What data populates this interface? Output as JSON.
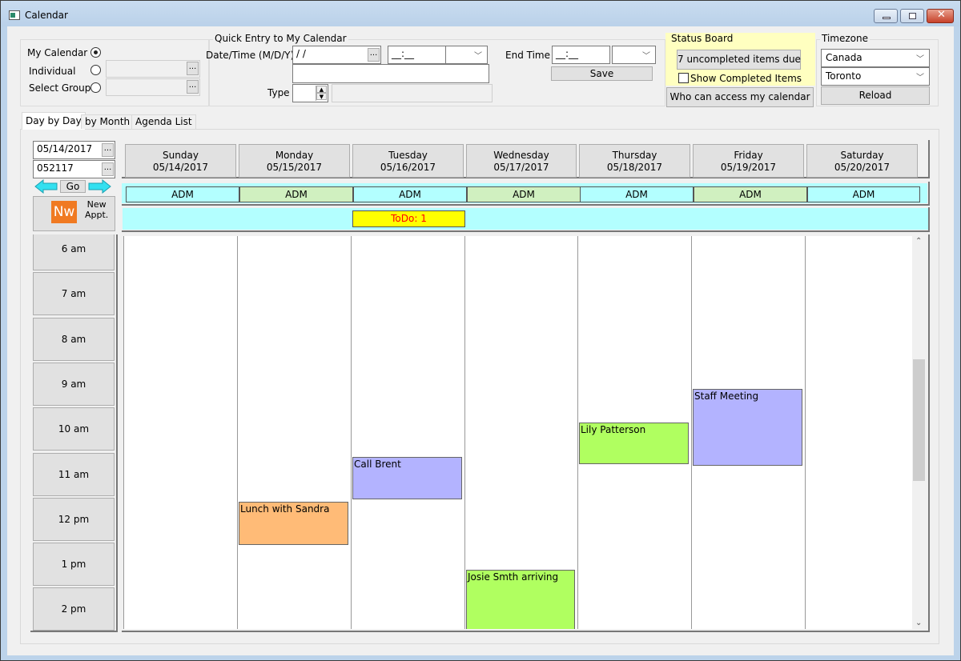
{
  "window": {
    "title": "Calendar",
    "controls": [
      "minimize",
      "maximize",
      "close"
    ]
  },
  "calendar_select": {
    "options": [
      {
        "label": "My Calendar",
        "selected": true,
        "value": null
      },
      {
        "label": "Individual",
        "selected": false,
        "value": ""
      },
      {
        "label": "Select Group",
        "selected": false,
        "value": ""
      }
    ],
    "browse_label": "..."
  },
  "quick_entry": {
    "legend": "Quick Entry to My Calendar",
    "datetime_label": "Date/Time (M/D/Y)",
    "date_value": " /  /",
    "time_value": "__:__",
    "ampm_value": "",
    "description_value": "",
    "type_label": "Type",
    "type_value": "",
    "type_desc_value": "",
    "end_time_label": "End Time",
    "end_time_value": "__:__",
    "end_ampm_value": "",
    "save_label": "Save",
    "browse_label": "..."
  },
  "status_board": {
    "legend": "Status Board",
    "uncompleted_button": "7 uncompleted items due",
    "show_completed_label": "Show Completed Items",
    "show_completed_checked": false,
    "access_button": "Who can access my calendar",
    "highlight_color": "#ffffc0"
  },
  "timezone": {
    "legend": "Timezone",
    "region": "Canada",
    "city": "Toronto",
    "reload_label": "Reload"
  },
  "tabs": [
    {
      "label": "Day by Day",
      "active": true
    },
    {
      "label": "by Month",
      "active": false
    },
    {
      "label": "Agenda List",
      "active": false
    }
  ],
  "nav": {
    "date_value": "05/14/2017",
    "code_value": "052117",
    "go_label": "Go",
    "browse_label": "...",
    "new_appt_icon_text": "Nw",
    "new_appt_label_line1": "New",
    "new_appt_label_line2": "Appt."
  },
  "days": [
    {
      "name": "Sunday",
      "date": "05/14/2017",
      "adm": "ADM",
      "adm_color": "#b3ffff"
    },
    {
      "name": "Monday",
      "date": "05/15/2017",
      "adm": "ADM",
      "adm_color": "#d0f0c0"
    },
    {
      "name": "Tuesday",
      "date": "05/16/2017",
      "adm": "ADM",
      "adm_color": "#b3ffff"
    },
    {
      "name": "Wednesday",
      "date": "05/17/2017",
      "adm": "ADM",
      "adm_color": "#d0f0c0"
    },
    {
      "name": "Thursday",
      "date": "05/18/2017",
      "adm": "ADM",
      "adm_color": "#b3ffff"
    },
    {
      "name": "Friday",
      "date": "05/19/2017",
      "adm": "ADM",
      "adm_color": "#d0f0c0"
    },
    {
      "name": "Saturday",
      "date": "05/20/2017",
      "adm": "ADM",
      "adm_color": "#b3ffff"
    }
  ],
  "todo_bar": {
    "day_index": 2,
    "label": "ToDo: 1",
    "bg_color": "#ffff00",
    "text_color": "#ff0000",
    "row_color": "#b3ffff"
  },
  "hours": [
    "6 am",
    "7 am",
    "8 am",
    "9 am",
    "10 am",
    "11 am",
    "12 pm",
    "1 pm",
    "2 pm"
  ],
  "events": [
    {
      "title": "Lunch with Sandra",
      "day_index": 1,
      "start_hour": 11.83,
      "end_hour": 12.78,
      "color": "#ffbb77"
    },
    {
      "title": "Call Brent",
      "day_index": 2,
      "start_hour": 10.83,
      "end_hour": 11.78,
      "color": "#b3b3ff"
    },
    {
      "title": "Josie Smth arriving",
      "day_index": 3,
      "start_hour": 13.33,
      "end_hour": 15.0,
      "color": "#b0ff60"
    },
    {
      "title": "Lily Patterson",
      "day_index": 4,
      "start_hour": 10.07,
      "end_hour": 11.0,
      "color": "#b0ff60"
    },
    {
      "title": "Staff Meeting",
      "day_index": 5,
      "start_hour": 9.33,
      "end_hour": 11.03,
      "color": "#b3b3ff"
    }
  ],
  "scrollbar": {
    "position_fraction": 0.45,
    "visible_fraction": 0.33
  }
}
